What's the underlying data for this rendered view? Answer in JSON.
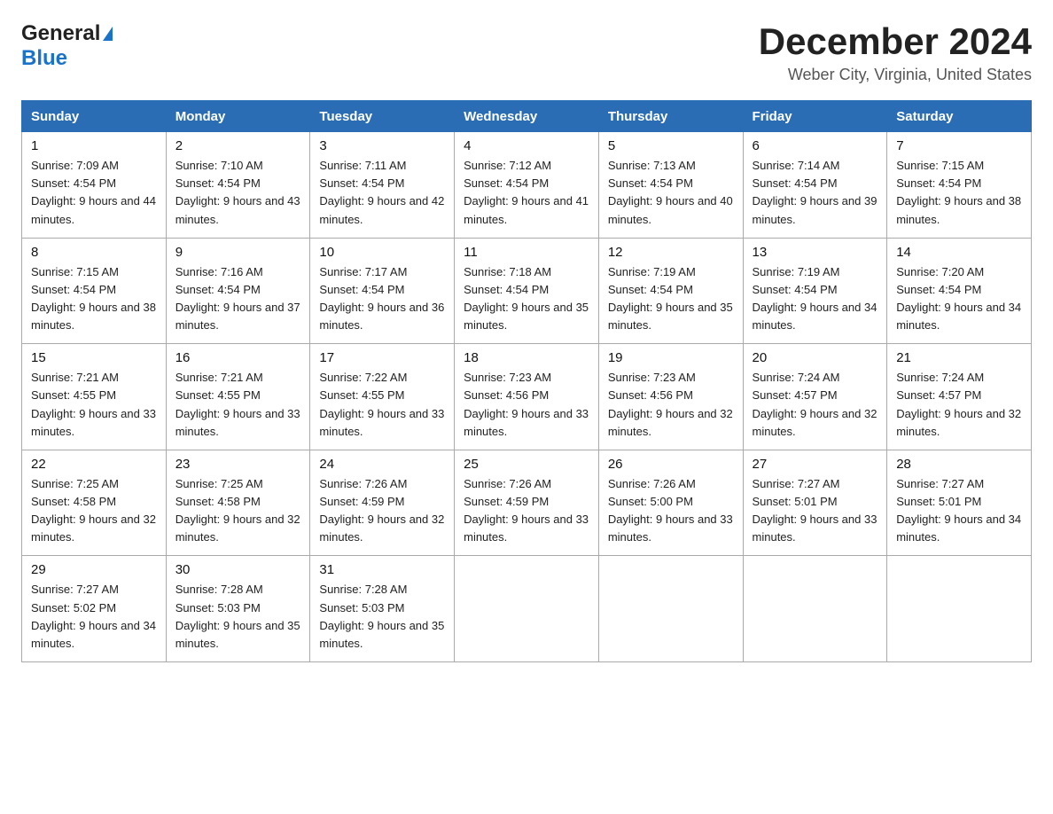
{
  "header": {
    "logo_general": "General",
    "logo_blue": "Blue",
    "month_year": "December 2024",
    "location": "Weber City, Virginia, United States"
  },
  "weekdays": [
    "Sunday",
    "Monday",
    "Tuesday",
    "Wednesday",
    "Thursday",
    "Friday",
    "Saturday"
  ],
  "weeks": [
    [
      {
        "day": "1",
        "sunrise": "Sunrise: 7:09 AM",
        "sunset": "Sunset: 4:54 PM",
        "daylight": "Daylight: 9 hours and 44 minutes."
      },
      {
        "day": "2",
        "sunrise": "Sunrise: 7:10 AM",
        "sunset": "Sunset: 4:54 PM",
        "daylight": "Daylight: 9 hours and 43 minutes."
      },
      {
        "day": "3",
        "sunrise": "Sunrise: 7:11 AM",
        "sunset": "Sunset: 4:54 PM",
        "daylight": "Daylight: 9 hours and 42 minutes."
      },
      {
        "day": "4",
        "sunrise": "Sunrise: 7:12 AM",
        "sunset": "Sunset: 4:54 PM",
        "daylight": "Daylight: 9 hours and 41 minutes."
      },
      {
        "day": "5",
        "sunrise": "Sunrise: 7:13 AM",
        "sunset": "Sunset: 4:54 PM",
        "daylight": "Daylight: 9 hours and 40 minutes."
      },
      {
        "day": "6",
        "sunrise": "Sunrise: 7:14 AM",
        "sunset": "Sunset: 4:54 PM",
        "daylight": "Daylight: 9 hours and 39 minutes."
      },
      {
        "day": "7",
        "sunrise": "Sunrise: 7:15 AM",
        "sunset": "Sunset: 4:54 PM",
        "daylight": "Daylight: 9 hours and 38 minutes."
      }
    ],
    [
      {
        "day": "8",
        "sunrise": "Sunrise: 7:15 AM",
        "sunset": "Sunset: 4:54 PM",
        "daylight": "Daylight: 9 hours and 38 minutes."
      },
      {
        "day": "9",
        "sunrise": "Sunrise: 7:16 AM",
        "sunset": "Sunset: 4:54 PM",
        "daylight": "Daylight: 9 hours and 37 minutes."
      },
      {
        "day": "10",
        "sunrise": "Sunrise: 7:17 AM",
        "sunset": "Sunset: 4:54 PM",
        "daylight": "Daylight: 9 hours and 36 minutes."
      },
      {
        "day": "11",
        "sunrise": "Sunrise: 7:18 AM",
        "sunset": "Sunset: 4:54 PM",
        "daylight": "Daylight: 9 hours and 35 minutes."
      },
      {
        "day": "12",
        "sunrise": "Sunrise: 7:19 AM",
        "sunset": "Sunset: 4:54 PM",
        "daylight": "Daylight: 9 hours and 35 minutes."
      },
      {
        "day": "13",
        "sunrise": "Sunrise: 7:19 AM",
        "sunset": "Sunset: 4:54 PM",
        "daylight": "Daylight: 9 hours and 34 minutes."
      },
      {
        "day": "14",
        "sunrise": "Sunrise: 7:20 AM",
        "sunset": "Sunset: 4:54 PM",
        "daylight": "Daylight: 9 hours and 34 minutes."
      }
    ],
    [
      {
        "day": "15",
        "sunrise": "Sunrise: 7:21 AM",
        "sunset": "Sunset: 4:55 PM",
        "daylight": "Daylight: 9 hours and 33 minutes."
      },
      {
        "day": "16",
        "sunrise": "Sunrise: 7:21 AM",
        "sunset": "Sunset: 4:55 PM",
        "daylight": "Daylight: 9 hours and 33 minutes."
      },
      {
        "day": "17",
        "sunrise": "Sunrise: 7:22 AM",
        "sunset": "Sunset: 4:55 PM",
        "daylight": "Daylight: 9 hours and 33 minutes."
      },
      {
        "day": "18",
        "sunrise": "Sunrise: 7:23 AM",
        "sunset": "Sunset: 4:56 PM",
        "daylight": "Daylight: 9 hours and 33 minutes."
      },
      {
        "day": "19",
        "sunrise": "Sunrise: 7:23 AM",
        "sunset": "Sunset: 4:56 PM",
        "daylight": "Daylight: 9 hours and 32 minutes."
      },
      {
        "day": "20",
        "sunrise": "Sunrise: 7:24 AM",
        "sunset": "Sunset: 4:57 PM",
        "daylight": "Daylight: 9 hours and 32 minutes."
      },
      {
        "day": "21",
        "sunrise": "Sunrise: 7:24 AM",
        "sunset": "Sunset: 4:57 PM",
        "daylight": "Daylight: 9 hours and 32 minutes."
      }
    ],
    [
      {
        "day": "22",
        "sunrise": "Sunrise: 7:25 AM",
        "sunset": "Sunset: 4:58 PM",
        "daylight": "Daylight: 9 hours and 32 minutes."
      },
      {
        "day": "23",
        "sunrise": "Sunrise: 7:25 AM",
        "sunset": "Sunset: 4:58 PM",
        "daylight": "Daylight: 9 hours and 32 minutes."
      },
      {
        "day": "24",
        "sunrise": "Sunrise: 7:26 AM",
        "sunset": "Sunset: 4:59 PM",
        "daylight": "Daylight: 9 hours and 32 minutes."
      },
      {
        "day": "25",
        "sunrise": "Sunrise: 7:26 AM",
        "sunset": "Sunset: 4:59 PM",
        "daylight": "Daylight: 9 hours and 33 minutes."
      },
      {
        "day": "26",
        "sunrise": "Sunrise: 7:26 AM",
        "sunset": "Sunset: 5:00 PM",
        "daylight": "Daylight: 9 hours and 33 minutes."
      },
      {
        "day": "27",
        "sunrise": "Sunrise: 7:27 AM",
        "sunset": "Sunset: 5:01 PM",
        "daylight": "Daylight: 9 hours and 33 minutes."
      },
      {
        "day": "28",
        "sunrise": "Sunrise: 7:27 AM",
        "sunset": "Sunset: 5:01 PM",
        "daylight": "Daylight: 9 hours and 34 minutes."
      }
    ],
    [
      {
        "day": "29",
        "sunrise": "Sunrise: 7:27 AM",
        "sunset": "Sunset: 5:02 PM",
        "daylight": "Daylight: 9 hours and 34 minutes."
      },
      {
        "day": "30",
        "sunrise": "Sunrise: 7:28 AM",
        "sunset": "Sunset: 5:03 PM",
        "daylight": "Daylight: 9 hours and 35 minutes."
      },
      {
        "day": "31",
        "sunrise": "Sunrise: 7:28 AM",
        "sunset": "Sunset: 5:03 PM",
        "daylight": "Daylight: 9 hours and 35 minutes."
      },
      null,
      null,
      null,
      null
    ]
  ]
}
